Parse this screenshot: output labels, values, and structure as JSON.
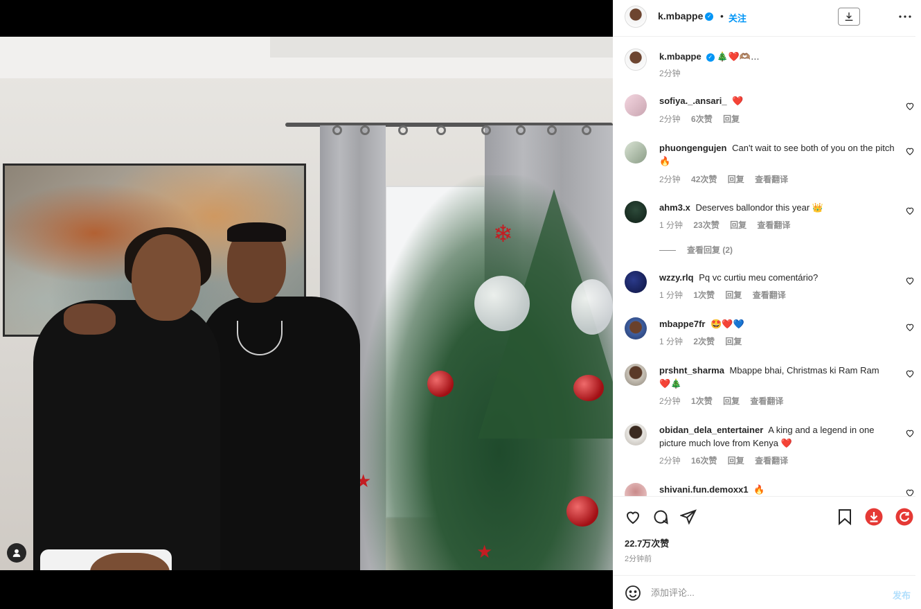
{
  "post": {
    "username": "k.mbappe",
    "follow_label": "关注",
    "separator": "•",
    "caption_emojis": "🎄❤️🫶🏽…",
    "caption_time": "2分钟",
    "likes": "22.7万次赞",
    "posted_time": "2分钟前"
  },
  "comments": [
    {
      "user": "sofiya._.ansari_",
      "text": "",
      "emojis": "❤️",
      "time": "2分钟",
      "likes": "6次赞",
      "reply": "回复",
      "translate": ""
    },
    {
      "user": "phuongengujen",
      "text": "Can't wait to see both of you on the pitch",
      "emojis": "🔥",
      "time": "2分钟",
      "likes": "42次赞",
      "reply": "回复",
      "translate": "查看翻译"
    },
    {
      "user": "ahm3.x",
      "text": "Deserves ballondor this year",
      "emojis": "👑",
      "time": "1 分钟",
      "likes": "23次赞",
      "reply": "回复",
      "translate": "查看翻译"
    },
    {
      "user": "wzzy.rlq",
      "text": "Pq vc curtiu meu comentário?",
      "emojis": "",
      "time": "1 分钟",
      "likes": "1次赞",
      "reply": "回复",
      "translate": "查看翻译"
    },
    {
      "user": "mbappe7fr",
      "text": "",
      "emojis": "🤩❤️💙",
      "time": "1 分钟",
      "likes": "2次赞",
      "reply": "回复",
      "translate": ""
    },
    {
      "user": "prshnt_sharma",
      "text": "Mbappe bhai, Christmas ki Ram Ram",
      "emojis": "❤️🎄",
      "time": "2分钟",
      "likes": "1次赞",
      "reply": "回复",
      "translate": "查看翻译"
    },
    {
      "user": "obidan_dela_entertainer",
      "text": "A king and a legend in one picture much love from Kenya",
      "emojis": "❤️",
      "time": "2分钟",
      "likes": "16次赞",
      "reply": "回复",
      "translate": "查看翻译"
    },
    {
      "user": "shivani.fun.demoxx1",
      "text": "",
      "emojis": "🔥",
      "time": "",
      "likes": "",
      "reply": "",
      "translate": ""
    }
  ],
  "view_replies": "查看回复 (2)",
  "composer": {
    "placeholder": "添加评论...",
    "post_label": "发布"
  },
  "colors": {
    "accent": "#0095f6",
    "muted": "#8e8e8e",
    "download_red": "#e53935",
    "refresh_red": "#e53935"
  },
  "icons": [
    "heart-icon",
    "comment-icon",
    "share-icon",
    "bookmark-icon",
    "download-icon",
    "refresh-icon",
    "emoji-icon",
    "more-icon",
    "user-tag-icon"
  ]
}
